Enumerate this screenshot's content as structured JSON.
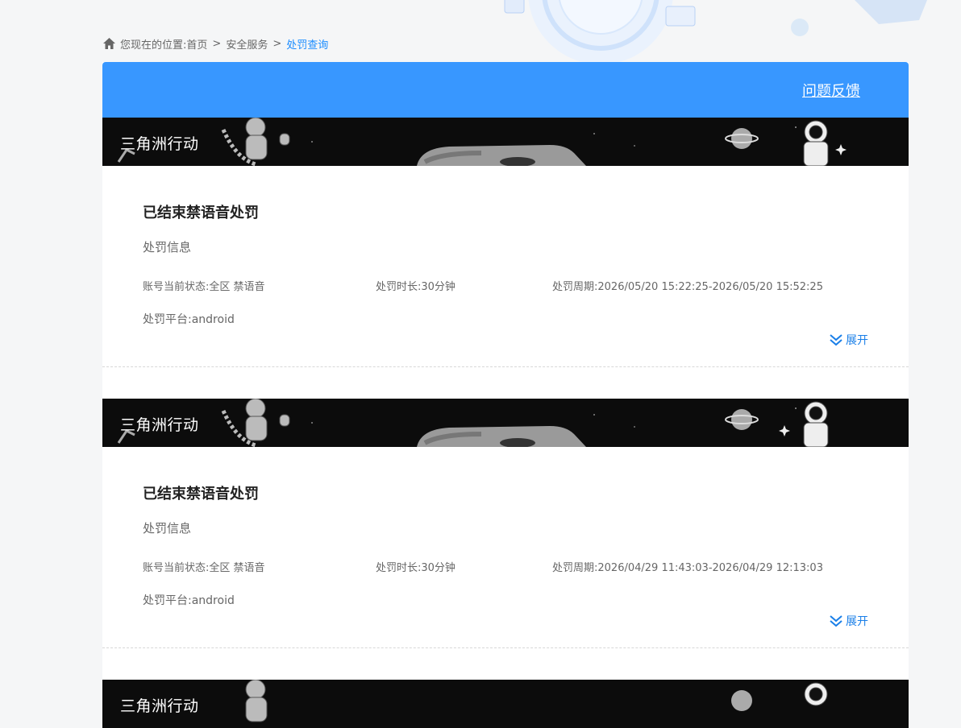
{
  "breadcrumb": {
    "prefix": "您现在的位置:",
    "items": [
      "首页",
      "安全服务",
      "处罚查询"
    ],
    "separator": ">"
  },
  "header": {
    "feedback_label": "问题反馈"
  },
  "records": [
    {
      "game": "三角洲行动",
      "title": "已结束禁语音处罚",
      "section": "处罚信息",
      "status": "账号当前状态:全区 禁语音",
      "duration": "处罚时长:30分钟",
      "period": "处罚周期:2026/05/20 15:22:25-2026/05/20 15:52:25",
      "platform": "处罚平台:android",
      "expand_label": "展开"
    },
    {
      "game": "三角洲行动",
      "title": "已结束禁语音处罚",
      "section": "处罚信息",
      "status": "账号当前状态:全区 禁语音",
      "duration": "处罚时长:30分钟",
      "period": "处罚周期:2026/04/29 11:43:03-2026/04/29 12:13:03",
      "platform": "处罚平台:android",
      "expand_label": "展开"
    },
    {
      "game": "三角洲行动"
    }
  ],
  "colors": {
    "accent": "#3897ff",
    "link": "#1a8cff",
    "banner_bg": "#0c0c0c"
  },
  "icons": {
    "home": "home-icon",
    "expand": "double-chevron-down-icon"
  }
}
